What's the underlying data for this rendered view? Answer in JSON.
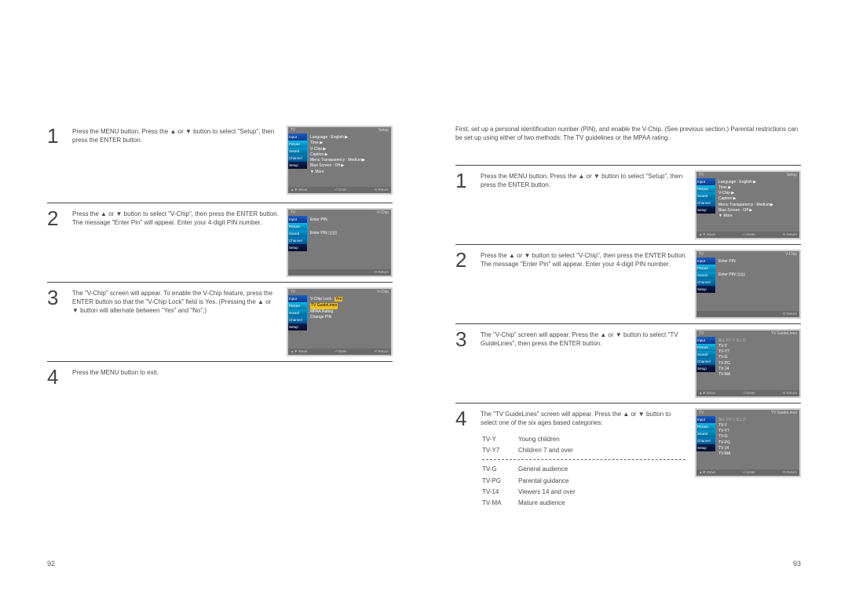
{
  "pageLeft": {
    "num": "92",
    "steps": [
      {
        "n": "1",
        "text": "Press the MENU button. Press the ▲ or ▼ button to select \"Setup\", then press the ENTER button."
      },
      {
        "n": "2",
        "text": "Press the ▲ or ▼ button to select \"V-Chip\", then press the ENTER button.\nThe message \"Enter Pin\" will appear. Enter your 4-digit PIN number."
      },
      {
        "n": "3",
        "text": "The \"V-Chip\" screen will appear. To enable the V-Chip feature, press the ENTER button so that the \"V-Chip Lock\" field is Yes. (Pressing the ▲ or ▼ button will alternate between \"Yes\" and \"No\".)"
      },
      {
        "n": "4",
        "text": "Press the MENU button to exit."
      }
    ]
  },
  "pageRight": {
    "num": "93",
    "intro": "First, set up a personal identification number (PIN), and enable the V-Chip. (See previous section.) Parental restrictions can be set up using either of two methods: The TV guidelines or the MPAA rating.",
    "steps": [
      {
        "n": "1",
        "text": "Press the MENU button. Press the ▲ or ▼ button to select \"Setup\", then press the ENTER button."
      },
      {
        "n": "2",
        "text": "Press the ▲ or ▼ button to select \"V-Chip\", then press the ENTER button.\nThe message \"Enter Pin\" will appear. Enter your 4-digit PIN number."
      },
      {
        "n": "3",
        "text": "The \"V-Chip\" screen will appear. Press the ▲ or ▼ button to select \"TV GuideLines\", then press the ENTER button."
      },
      {
        "n": "4",
        "text": "The \"TV GuideLines\" screen will appear. Press the ▲ or ▼ button to select one of the six ages based categories:"
      }
    ],
    "ratings": [
      {
        "code": "TV-Y",
        "desc": "Young children"
      },
      {
        "code": "TV-Y7",
        "desc": "Children 7 and over"
      },
      {
        "sep": true
      },
      {
        "code": "TV-G",
        "desc": "General audience"
      },
      {
        "code": "TV-PG",
        "desc": "Parental guidance"
      },
      {
        "code": "TV-14",
        "desc": "Viewers 14 and over"
      },
      {
        "code": "TV-MA",
        "desc": "Mature audience"
      }
    ]
  },
  "tv": {
    "title": "TV",
    "tabs": [
      "Input",
      "Picture",
      "Sound",
      "Channel",
      "Setup"
    ],
    "footer": {
      "move": "▲▼ Move",
      "enter": "⏎ Enter",
      "return": "⟲ Return"
    },
    "setup": {
      "headerR": "Setup",
      "lines": [
        "Language       : English  ▶",
        "Time                      ▶",
        "V-Chip                    ▶",
        "Caption                   ▶",
        "Menu Transparency : Medium▶",
        "Blue Screen    : Off      ▶",
        "▼ More"
      ]
    },
    "pin": {
      "headerR": "V-Chip",
      "line1": "Enter PIN",
      "line2": "Enter PIN  ▯▯▯▯"
    },
    "vchip": {
      "headerR": "V-Chip",
      "lines": [
        "V-Chip Lock       :",
        "TV GuideLines",
        "MPAA Rating",
        "Change PIN"
      ],
      "lockVal": "Yes"
    },
    "guidelines": {
      "headerR": "TV GuideLines",
      "cols": "ALL  FV  V  S  L  D",
      "rows": [
        "TV-Y",
        "TV-Y7",
        "TV-G",
        "TV-PG",
        "TV-14",
        "TV-MA"
      ]
    }
  }
}
